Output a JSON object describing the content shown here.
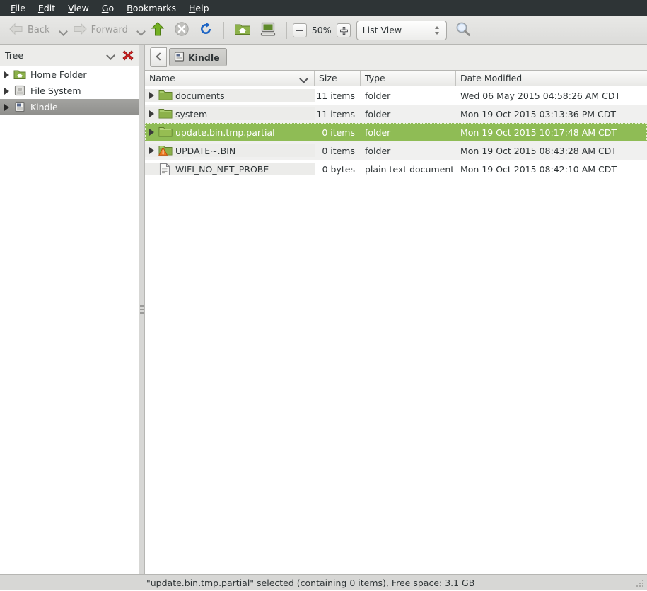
{
  "menubar": {
    "items": [
      {
        "label": "File",
        "mnemonic": "F"
      },
      {
        "label": "Edit",
        "mnemonic": "E"
      },
      {
        "label": "View",
        "mnemonic": "V"
      },
      {
        "label": "Go",
        "mnemonic": "G"
      },
      {
        "label": "Bookmarks",
        "mnemonic": "B"
      },
      {
        "label": "Help",
        "mnemonic": "H"
      }
    ]
  },
  "toolbar": {
    "back_label": "Back",
    "forward_label": "Forward",
    "up_icon": "up-arrow-icon",
    "stop_icon": "stop-icon",
    "reload_icon": "reload-icon",
    "home_icon": "home-folder-icon",
    "computer_icon": "computer-icon",
    "zoom_out_icon": "zoom-out-icon",
    "zoom_level": "50%",
    "zoom_in_icon": "zoom-in-icon",
    "view_mode": "List View",
    "search_icon": "search-icon"
  },
  "sidebar": {
    "title": "Tree",
    "collapse_icon": "chevron-down-icon",
    "close_icon": "close-icon",
    "items": [
      {
        "label": "Home Folder",
        "icon": "home-folder-icon",
        "selected": false
      },
      {
        "label": "File System",
        "icon": "drive-icon",
        "selected": false
      },
      {
        "label": "Kindle",
        "icon": "device-icon",
        "selected": true
      }
    ]
  },
  "pathbar": {
    "back_icon": "chevron-left-icon",
    "crumb_label": "Kindle",
    "crumb_icon": "device-icon"
  },
  "filelist": {
    "columns": [
      {
        "label": "Name",
        "sort_icon": "chevron-down-icon"
      },
      {
        "label": "Size"
      },
      {
        "label": "Type"
      },
      {
        "label": "Date Modified"
      }
    ],
    "rows": [
      {
        "name": "documents",
        "size": "11 items",
        "type": "folder",
        "date": "Wed 06 May 2015 04:58:26 AM CDT",
        "icon": "folder-icon",
        "expander": true,
        "selected": false,
        "stripe": false
      },
      {
        "name": "system",
        "size": "11 items",
        "type": "folder",
        "date": "Mon 19 Oct 2015 03:13:36 PM CDT",
        "icon": "folder-icon",
        "expander": true,
        "selected": false,
        "stripe": true
      },
      {
        "name": "update.bin.tmp.partial",
        "size": "0 items",
        "type": "folder",
        "date": "Mon 19 Oct 2015 10:17:48 AM CDT",
        "icon": "folder-icon",
        "expander": true,
        "selected": true,
        "stripe": false
      },
      {
        "name": "UPDATE~.BIN",
        "size": "0 items",
        "type": "folder",
        "date": "Mon 19 Oct 2015 08:43:28 AM CDT",
        "icon": "folder-warning-icon",
        "expander": true,
        "selected": false,
        "stripe": true
      },
      {
        "name": "WIFI_NO_NET_PROBE",
        "size": "0 bytes",
        "type": "plain text document",
        "date": "Mon 19 Oct 2015 08:42:10 AM CDT",
        "icon": "text-file-icon",
        "expander": false,
        "selected": false,
        "stripe": false
      }
    ]
  },
  "statusbar": {
    "text": "\"update.bin.tmp.partial\" selected (containing 0 items), Free space: 3.1 GB",
    "resize_icon": "resize-grip-icon"
  },
  "colors": {
    "selection_green": "#8fbc55",
    "menubar_bg": "#2e3436",
    "folder_green": "#8cb14a",
    "warning_orange": "#f07c23"
  }
}
